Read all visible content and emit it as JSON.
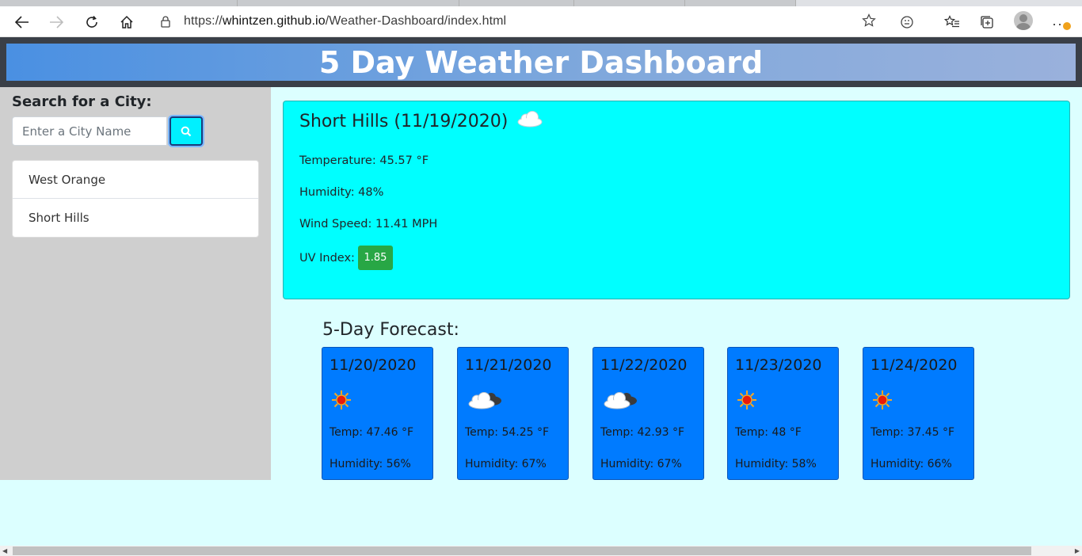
{
  "browser": {
    "url_prefix": "https://",
    "url_domain": "whintzen.github.io",
    "url_path": "/Weather-Dashboard/index.html"
  },
  "header": {
    "title": "5 Day Weather Dashboard"
  },
  "sidebar": {
    "label": "Search for a City:",
    "search": {
      "placeholder": "Enter a City Name",
      "value": ""
    },
    "history": [
      "West Orange",
      "Short Hills"
    ]
  },
  "current": {
    "title": "Short Hills (11/19/2020)",
    "icon": "cloud-icon",
    "temperature": "Temperature: 45.57 °F",
    "humidity": "Humidity: 48%",
    "wind": "Wind Speed: 11.41 MPH",
    "uv_label": "UV Index:",
    "uv_value": "1.85",
    "uv_color": "#28a745"
  },
  "forecast": {
    "title": "5-Day Forecast:",
    "days": [
      {
        "date": "11/20/2020",
        "icon": "sun-icon",
        "temp": "Temp: 47.46 °F",
        "humidity": "Humidity: 56%"
      },
      {
        "date": "11/21/2020",
        "icon": "cloud-icon",
        "temp": "Temp: 54.25 °F",
        "humidity": "Humidity: 67%"
      },
      {
        "date": "11/22/2020",
        "icon": "cloud-icon",
        "temp": "Temp: 42.93 °F",
        "humidity": "Humidity: 67%"
      },
      {
        "date": "11/23/2020",
        "icon": "sun-icon",
        "temp": "Temp: 48 °F",
        "humidity": "Humidity: 58%"
      },
      {
        "date": "11/24/2020",
        "icon": "sun-icon",
        "temp": "Temp: 37.45 °F",
        "humidity": "Humidity: 66%"
      }
    ]
  },
  "colors": {
    "current_bg": "#00ffff",
    "card_bg": "#007bff",
    "page_bg": "#dcffff",
    "sidebar_bg": "#cfcfcf"
  }
}
